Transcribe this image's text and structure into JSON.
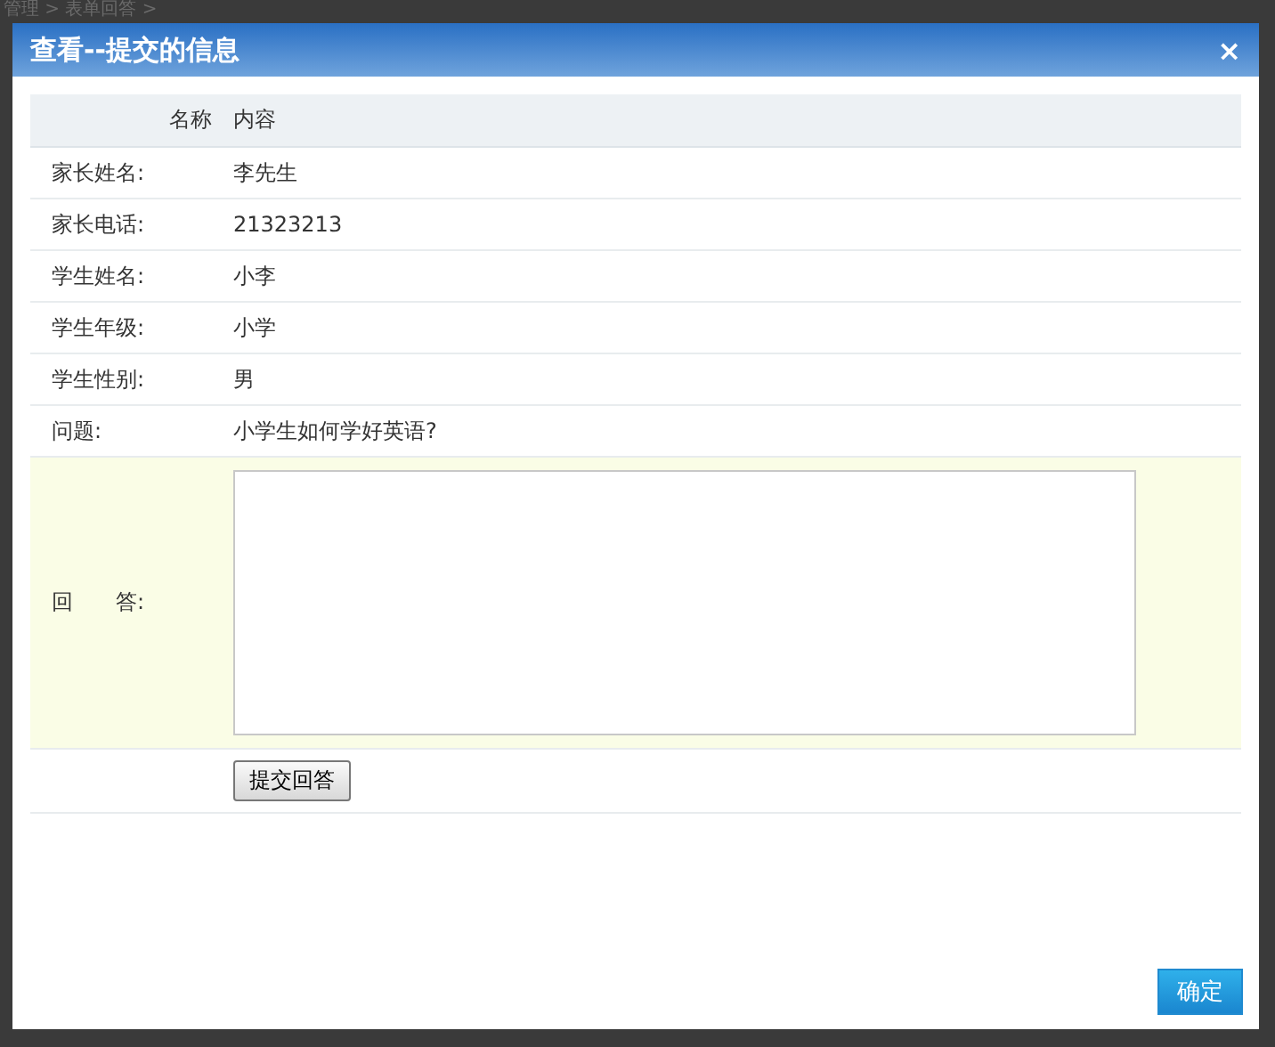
{
  "background": {
    "breadcrumb": "管理 > 表单回答 >"
  },
  "dialog": {
    "title": "查看--提交的信息",
    "close": "×",
    "table": {
      "columns": [
        "名称",
        "内容"
      ],
      "rows": [
        {
          "label": "家长姓名:",
          "value": "李先生"
        },
        {
          "label": "家长电话:",
          "value": "21323213"
        },
        {
          "label": "学生姓名:",
          "value": "小李"
        },
        {
          "label": "学生年级:",
          "value": "小学"
        },
        {
          "label": "学生性别:",
          "value": "男"
        },
        {
          "label": "问题:",
          "value": "小学生如何学好英语?"
        }
      ],
      "answer": {
        "label": "回　　答:"
      },
      "submit_button": "提交回答"
    },
    "ok_button": "确定"
  }
}
